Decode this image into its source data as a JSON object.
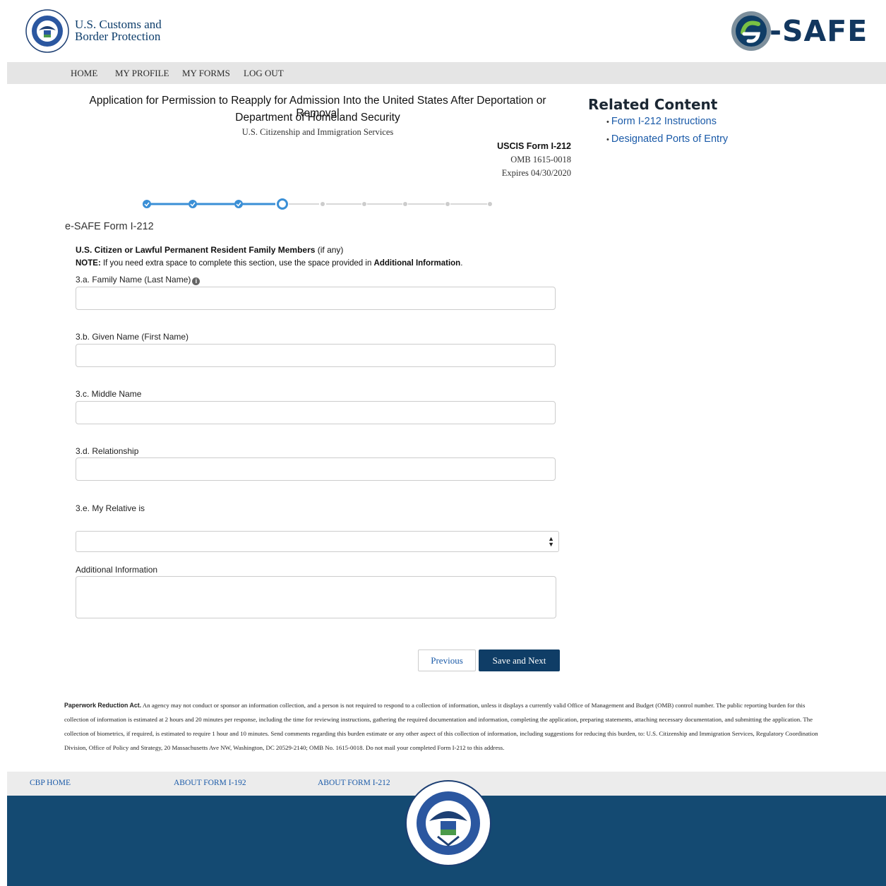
{
  "header": {
    "agency_line1": "U.S. Customs and",
    "agency_line2": "Border Protection",
    "seal_icon": "dhs-seal-icon",
    "logo_text": "-SAFE",
    "logo_icon": "esafe-e-logo-icon"
  },
  "nav": {
    "home": "HOME",
    "profile": "MY PROFILE",
    "forms": "MY FORMS",
    "logout": "LOG OUT"
  },
  "title": {
    "line1": "Application for Permission to Reapply for Admission Into the United States After Deportation or Removal",
    "line2": "Department of Homeland Security",
    "line3": "U.S. Citizenship and Immigration Services"
  },
  "form_meta": {
    "form_no": "USCIS Form I-212",
    "omb": "OMB 1615-0018",
    "expires": "Expires 04/30/2020"
  },
  "related": {
    "heading": "Related Content",
    "links": [
      "Form I-212 Instructions",
      "Designated Ports of Entry"
    ]
  },
  "stepper": {
    "total_steps": 9,
    "completed_steps": 3,
    "current_step": 4
  },
  "form": {
    "heading": "e-SAFE Form I-212",
    "section_title": "U.S. Citizen or Lawful Permanent Resident Family Members",
    "section_suffix": " (if any)",
    "note_label": "NOTE:",
    "note_text": " If you need extra space to complete this section, use the space provided in ",
    "note_bold": "Additional Information",
    "note_end": ".",
    "fields": {
      "family_name_label": "3.a. Family Name (Last Name)",
      "family_name_value": "",
      "given_name_label": "3.b. Given Name (First Name)",
      "given_name_value": "",
      "middle_name_label": "3.c. Middle Name",
      "middle_name_value": "",
      "relationship_label": "3.d. Relationship",
      "relationship_value": "",
      "relative_is_label": "3.e. My Relative is",
      "relative_is_value": "",
      "additional_label": "Additional Information",
      "additional_value": ""
    },
    "previous_button": "Previous",
    "next_button": "Save and Next"
  },
  "paperwork": {
    "title": "Paperwork Reduction Act.",
    "text": " An agency may not conduct or sponsor an information collection, and a person is not required to respond to a collection of information, unless it displays a currently valid Office of Management and Budget (OMB) control number.  The public reporting burden for this collection of information is estimated at 2 hours and 20 minutes per response, including the time for reviewing instructions, gathering the required documentation and information, completing the application, preparing statements, attaching necessary documentation, and submitting the application.  The collection of biometrics, if required, is estimated to require 1 hour and 10 minutes.  Send comments regarding this burden estimate or any other aspect of this collection of information, including suggestions for reducing this burden, to:  U.S. Citizenship and Immigration Services, Regulatory Coordination Division, Office of Policy and Strategy, 20 Massachusetts Ave NW, Washington, DC 20529-2140; OMB No. 1615-0018.  Do not mail your completed Form I-212 to this address."
  },
  "footer": {
    "cbp_home": "CBP HOME",
    "about_192": "ABOUT FORM I-192",
    "about_212": "ABOUT FORM I-212",
    "seal_icon": "dhs-seal-icon"
  },
  "colors": {
    "brand_navy": "#0f3d66",
    "footer_blue": "#144a72",
    "link_blue": "#1a5aa8",
    "step_blue": "#3a8fd6"
  }
}
